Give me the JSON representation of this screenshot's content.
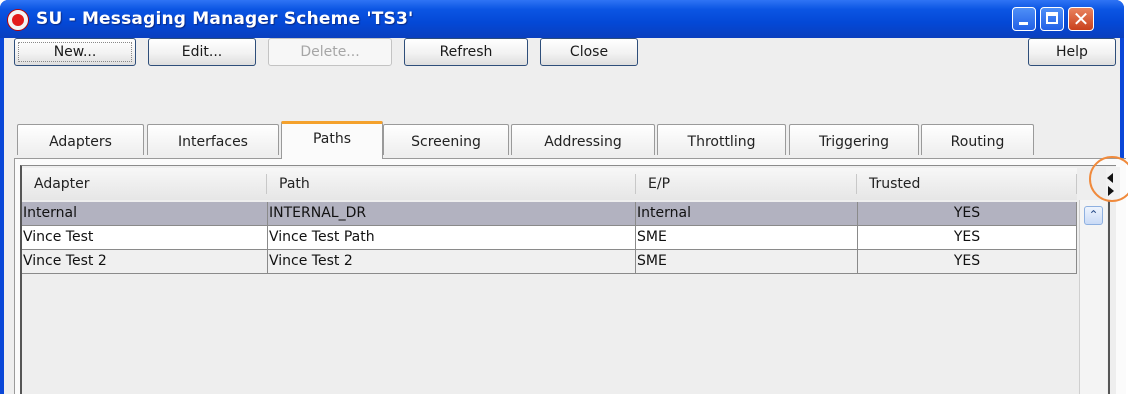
{
  "window": {
    "title": "SU - Messaging Manager Scheme 'TS3'",
    "controls": {
      "minimize": "minimize-icon",
      "maximize": "maximize-icon",
      "close": "close-icon"
    }
  },
  "toolbar": {
    "new_label": "New...",
    "edit_label": "Edit...",
    "delete_label": "Delete...",
    "refresh_label": "Refresh",
    "close_label": "Close",
    "help_label": "Help"
  },
  "tabs": [
    "Adapters",
    "Interfaces",
    "Paths",
    "Screening",
    "Addressing",
    "Throttling",
    "Triggering",
    "Routing"
  ],
  "active_tab": "Paths",
  "table": {
    "columns": [
      "Adapter",
      "Path",
      "E/P",
      "Trusted"
    ],
    "rows": [
      [
        "Internal",
        "INTERNAL_DR",
        "Internal",
        "YES"
      ],
      [
        "Vince Test",
        "Vince Test Path",
        "SME",
        "YES"
      ],
      [
        "Vince Test 2",
        "Vince Test 2",
        "SME",
        "YES"
      ]
    ],
    "selected_row": 0
  },
  "colors": {
    "titlebar": "#0b55e3",
    "active_tab_accent": "#f4a12c",
    "selected_row": "#b2b2c0",
    "highlight_circle": "#f08a3c"
  },
  "icons": {
    "app": "oracle-logo-icon",
    "scroll_up": "chevron-up-icon",
    "column_control": "column-resize-arrows-icon"
  }
}
